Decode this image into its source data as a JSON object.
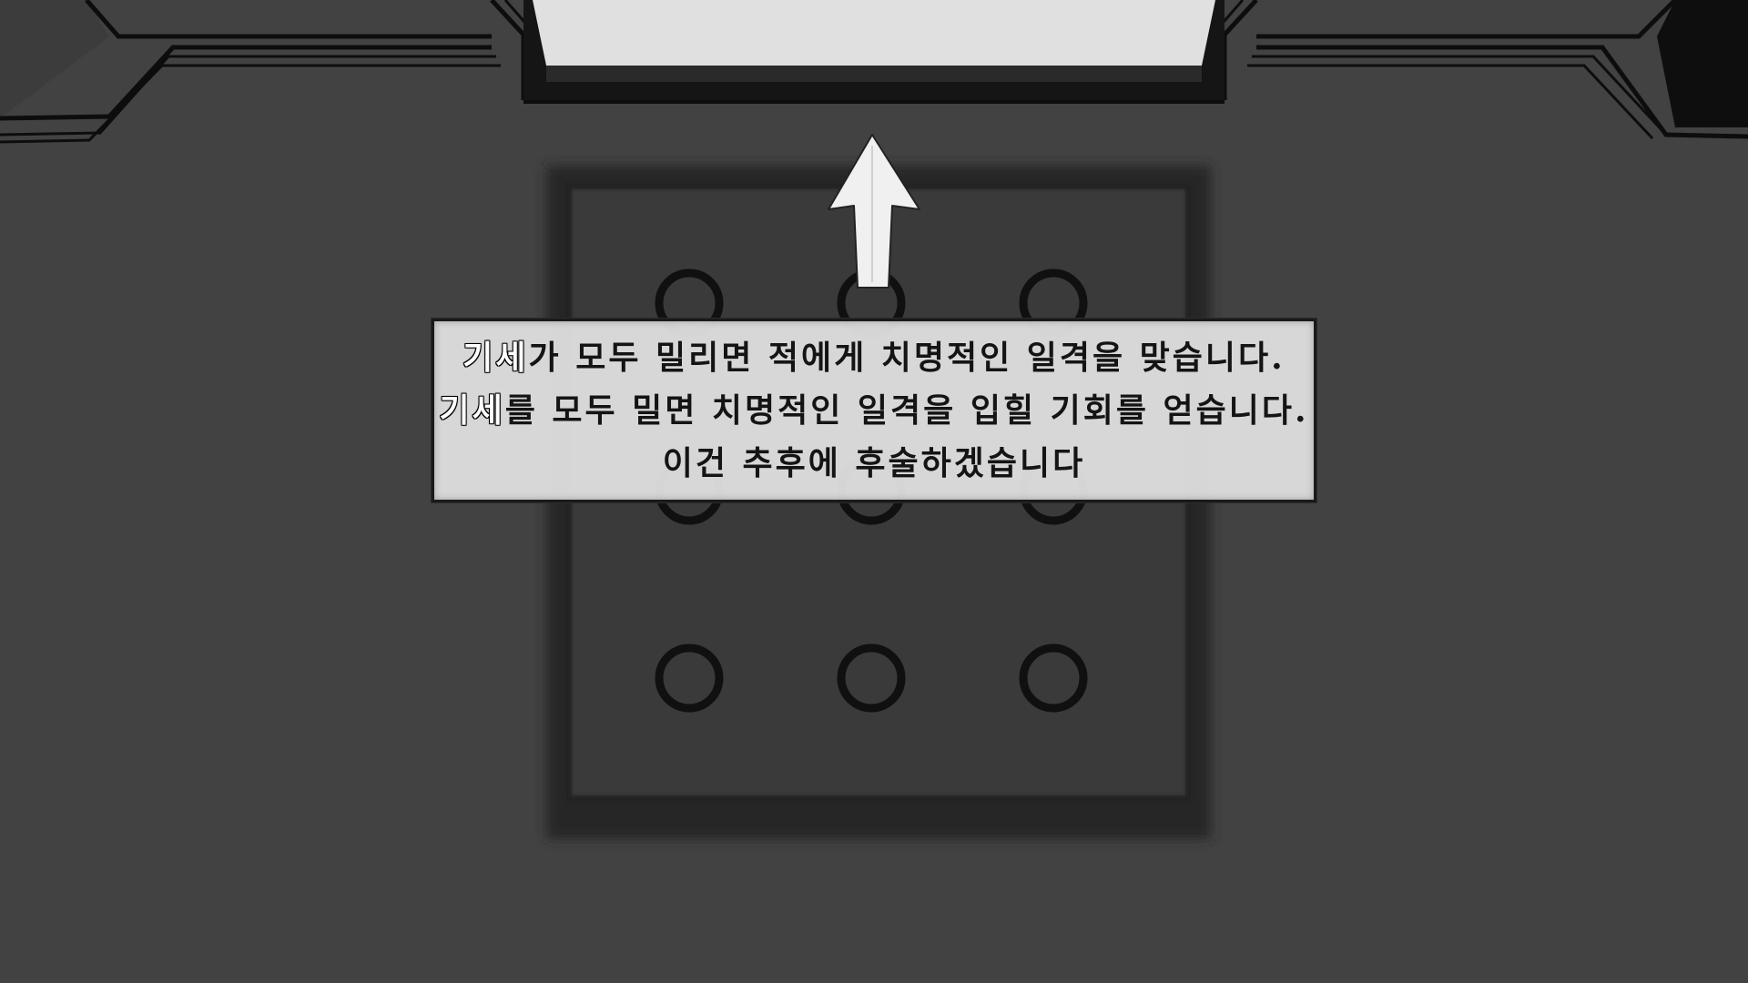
{
  "tutorial": {
    "line1": {
      "keyword": "기세",
      "rest": "가 모두 밀리면 적에게 치명적인 일격을 맞습니다."
    },
    "line2": {
      "keyword": "기세",
      "rest": "를 모두 밀면 치명적인 일격을 입힐 기회를 얻습니다."
    },
    "line3": {
      "text": "이건 추후에 후술하겠습니다"
    }
  },
  "board": {
    "rows": 3,
    "cols": 3,
    "arrow_direction": "up"
  },
  "colors": {
    "background": "#424242",
    "board": "#3a3a3a",
    "door_light": "#e0e0e0",
    "ink": "#101010",
    "arrow": "#f0f0f0"
  }
}
